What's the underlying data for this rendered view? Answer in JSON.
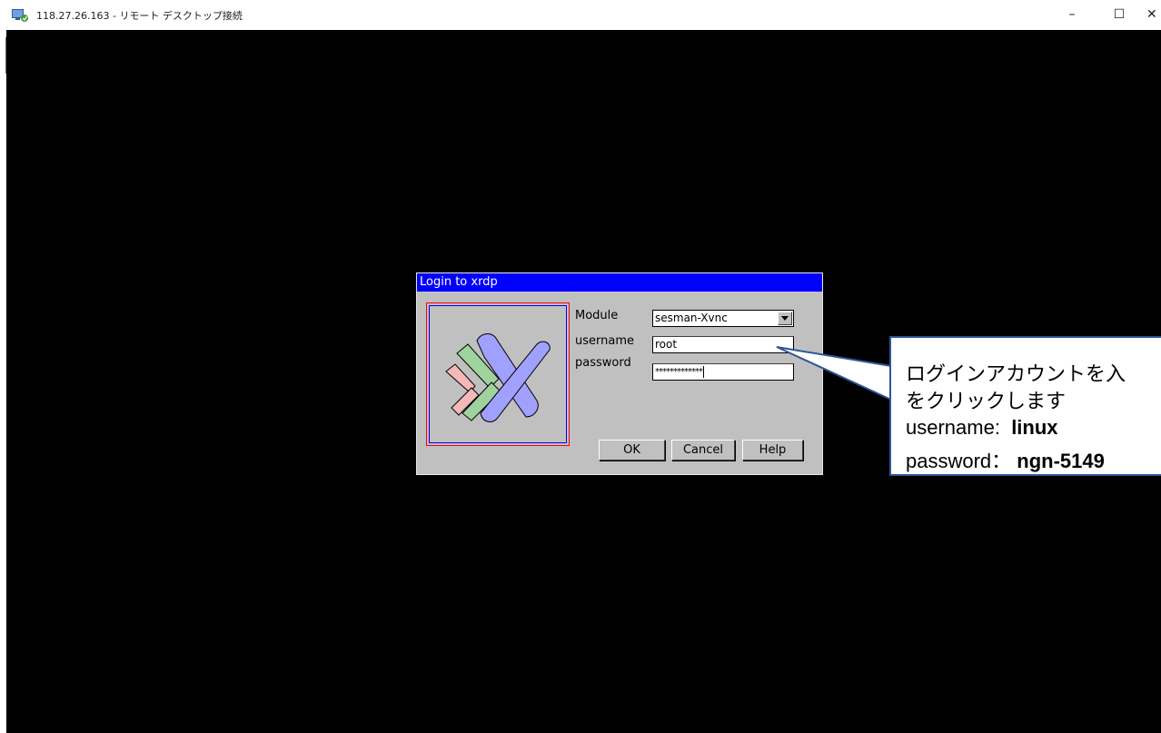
{
  "window": {
    "title": "118.27.26.163 - リモート デスクトップ接続",
    "minimize_glyph": "–",
    "maximize_glyph": "☐",
    "close_glyph": "✕"
  },
  "dialog": {
    "title": "Login to xrdp",
    "module_label": "Module",
    "module_value": "sesman-Xvnc",
    "username_label": "username",
    "username_value": "root",
    "password_label": "password",
    "password_value": "*************",
    "ok_label": "OK",
    "cancel_label": "Cancel",
    "help_label": "Help"
  },
  "callout": {
    "line1": "ログインアカウントを入",
    "line2": "をクリックします",
    "username_label": "username:",
    "username_value": "linux",
    "password_label": "password：",
    "password_value": "ngn-5149"
  },
  "colors": {
    "desktop": "#000000",
    "dialog_bg": "#c0c0c0",
    "dialog_title_bg": "#0000ff",
    "callout_border": "#2f5597"
  },
  "icons": {
    "app": "remote-desktop-icon",
    "logo": "xrdp-logo"
  }
}
